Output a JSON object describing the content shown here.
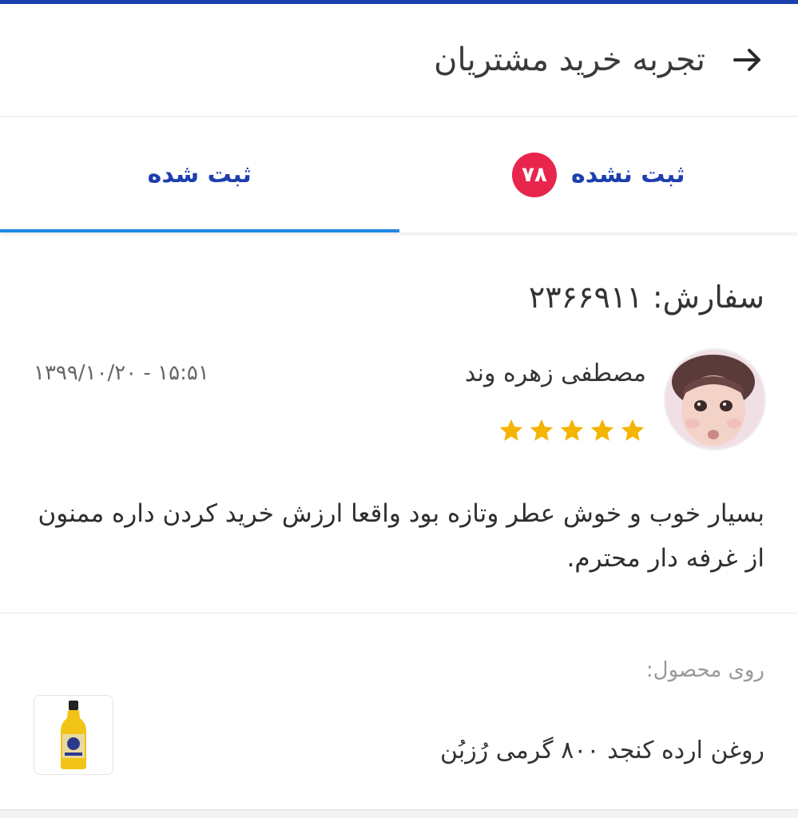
{
  "header": {
    "title": "تجربه خرید مشتریان",
    "back_icon": "arrow-right-icon"
  },
  "tabs": [
    {
      "label": "ثبت نشده",
      "badge": "۷۸",
      "active": false
    },
    {
      "label": "ثبت شده",
      "active": true
    }
  ],
  "colors": {
    "accent_dark": "#1d3fae",
    "tab_indicator": "#1e88e5",
    "badge": "#e8254c",
    "star": "#f4b400"
  },
  "review": {
    "order_label": "سفارش:",
    "order_number": "۲۳۶۶۹۱۱",
    "reviewer_name": "مصطفی زهره وند",
    "rating": 5,
    "rating_max": 5,
    "date": "۱۵:۵۱ - ۱۳۹۹/۱۰/۲۰",
    "text": "بسیار خوب و خوش عطر وتازه بود واقعا ارزش خرید کردن داره ممنون از غرفه دار محترم."
  },
  "product": {
    "caption": "روی محصول:",
    "name": "روغن ارده کنجد ۸۰۰ گرمی رُزبُن"
  }
}
